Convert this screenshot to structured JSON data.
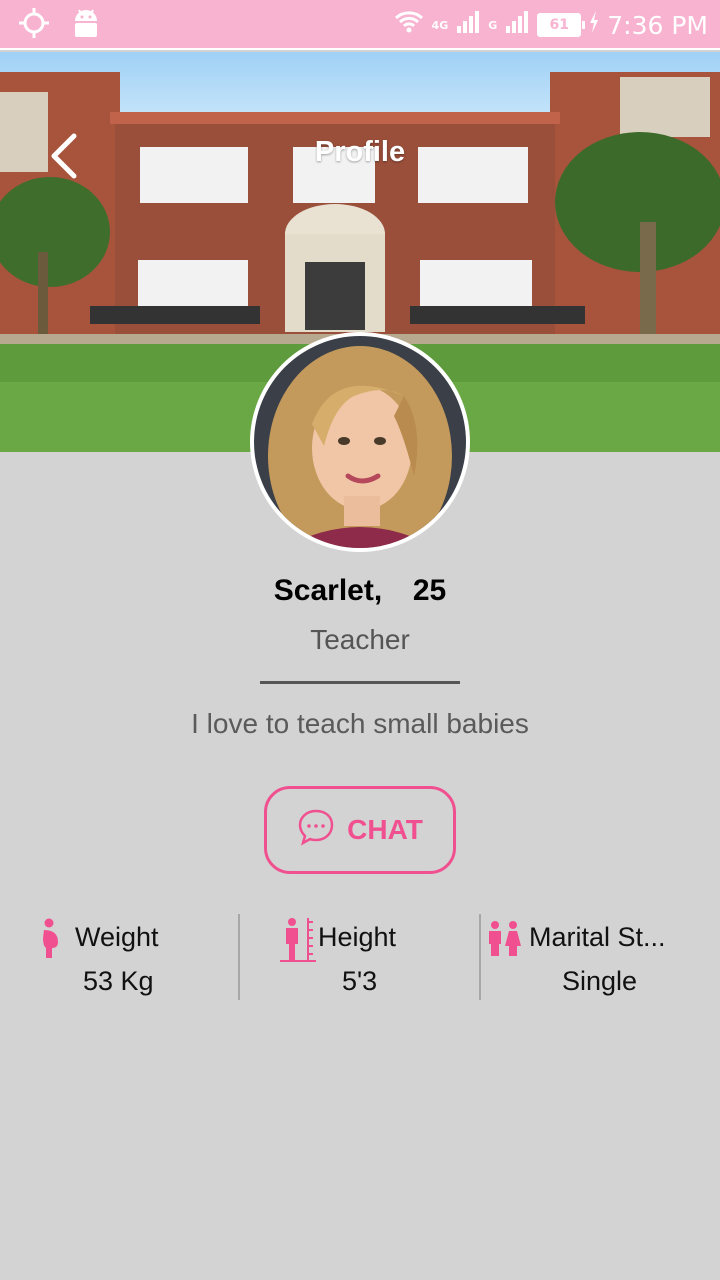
{
  "status_bar": {
    "time": "7:36 PM",
    "battery": "61",
    "network_1": "4G",
    "network_2": "G"
  },
  "header": {
    "title": "Profile"
  },
  "profile": {
    "name": "Scarlet,",
    "age": "25",
    "profession": "Teacher",
    "bio": "I love to teach small babies"
  },
  "chat_button": {
    "label": "CHAT"
  },
  "stats": [
    {
      "label": "Weight",
      "value": "53 Kg",
      "icon": "weight-icon"
    },
    {
      "label": "Height",
      "value": "5'3",
      "icon": "height-icon"
    },
    {
      "label": "Marital St...",
      "value": "Single",
      "icon": "couple-icon"
    }
  ],
  "colors": {
    "status_bar_bg": "#f8b3d1",
    "accent": "#f0508f",
    "background": "#d3d3d3"
  }
}
